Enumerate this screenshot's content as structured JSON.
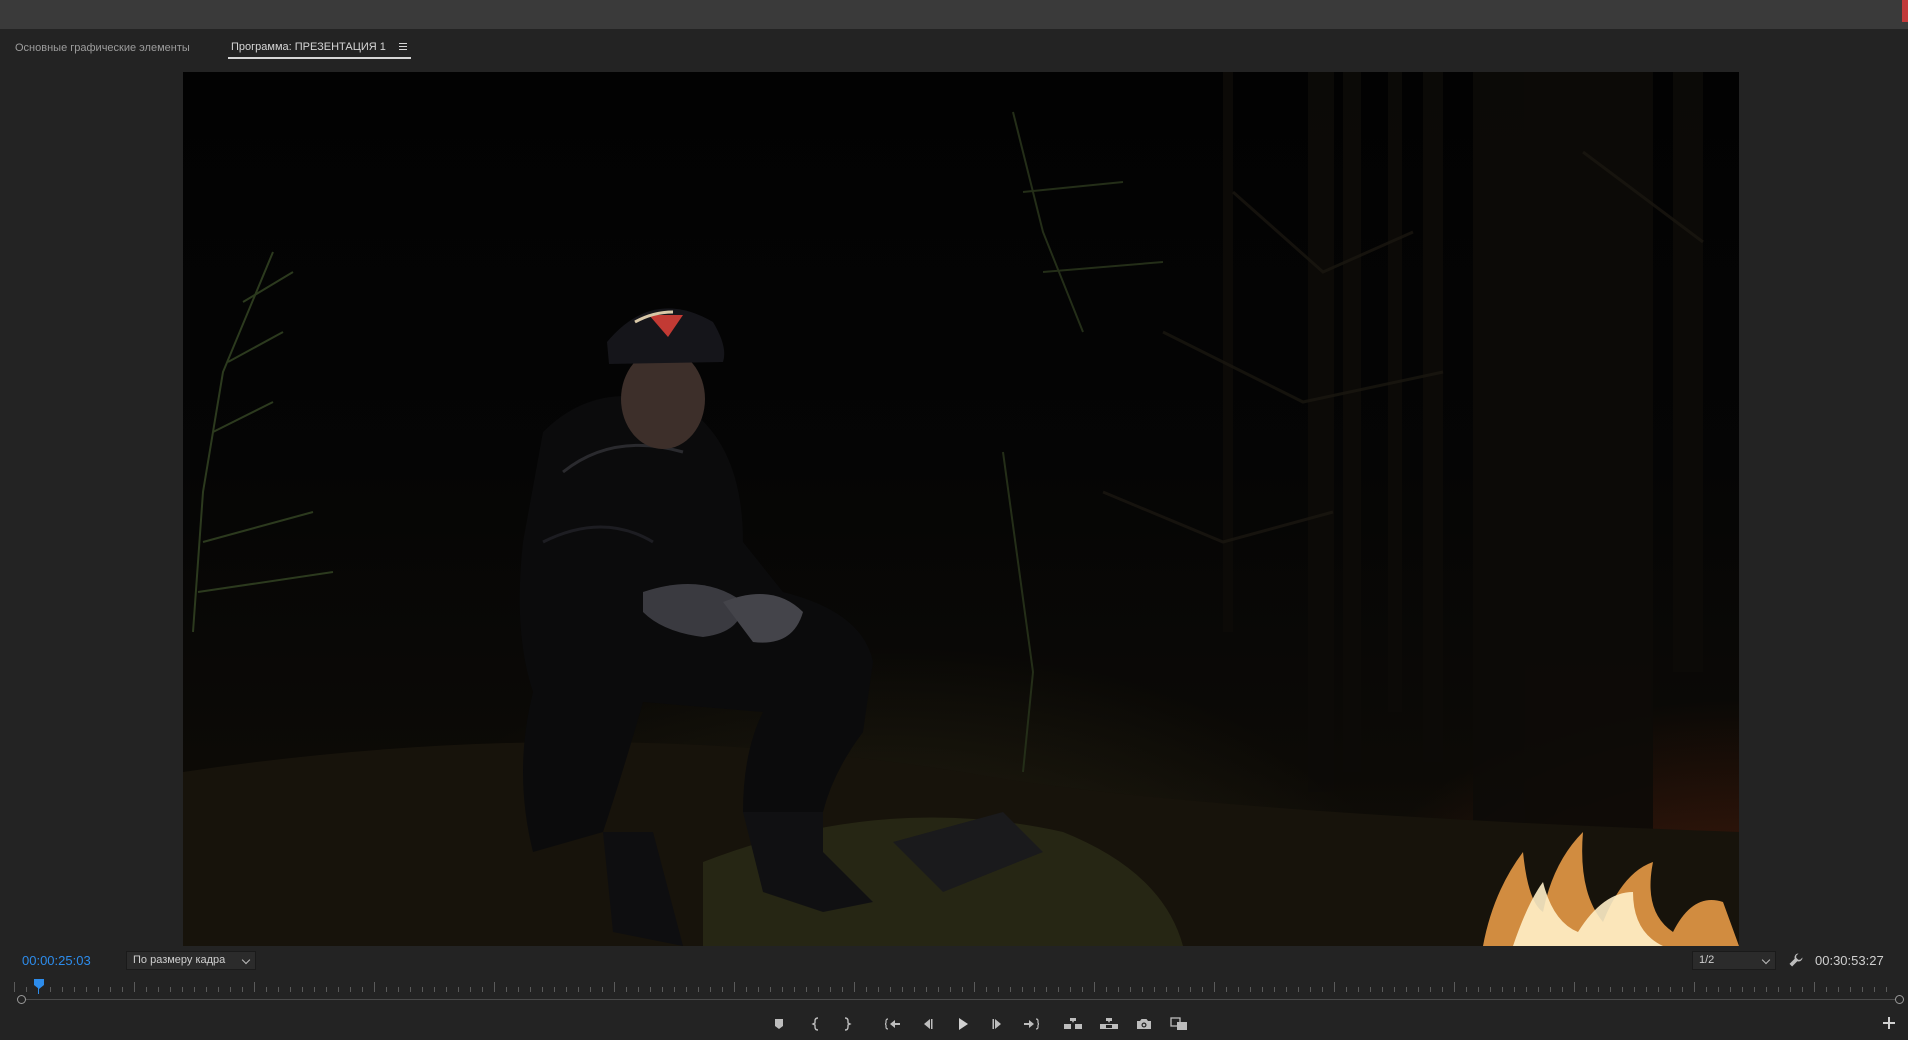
{
  "panel": {
    "tab_graphics": "Основные графические элементы",
    "tab_program": "Программа: ПРЕЗЕНТАЦИЯ 1"
  },
  "monitor": {
    "timecode_current": "00:00:25:03",
    "fit_option": "По размеру кадра",
    "resolution": "1/2",
    "timecode_total": "00:30:53:27",
    "playhead_position": 0.014
  },
  "transport": {
    "buttons": [
      "add-marker",
      "mark-in",
      "mark-out",
      "go-to-in",
      "step-back",
      "play",
      "step-forward",
      "go-to-out",
      "insert",
      "overwrite",
      "export-frame",
      "comparison-view"
    ]
  },
  "colors": {
    "accent": "#2d8ceb",
    "panel_bg": "#232323",
    "topbar_bg": "#3a3a3a"
  }
}
